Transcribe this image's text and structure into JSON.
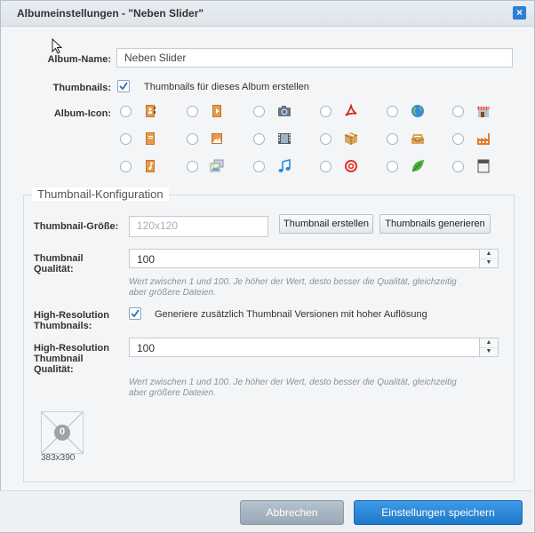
{
  "dialog": {
    "title": "Albumeinstellungen - \"Neben Slider\"",
    "close_icon": "close-icon"
  },
  "album": {
    "name_label": "Album-Name:",
    "name_value": "Neben Slider",
    "thumbnails_label": "Thumbnails:",
    "thumbnails_checked": true,
    "thumbnails_text": "Thumbnails für dieses Album erstellen",
    "icon_label": "Album-Icon:",
    "icons": [
      [
        "address-book-icon",
        "book-play-icon",
        "camera-icon",
        "pdf-icon",
        "globe-icon",
        "shop-icon"
      ],
      [
        "notebook-icon",
        "picture-icon",
        "film-icon",
        "box-icon",
        "inbox-icon",
        "factory-icon"
      ],
      [
        "music-book-icon",
        "images-icon",
        "music-note-icon",
        "target-icon",
        "leaf-icon",
        "document-icon"
      ]
    ]
  },
  "thumb": {
    "legend": "Thumbnail-Konfiguration",
    "size_label": "Thumbnail-Größe:",
    "size_placeholder": "120x120",
    "create_btn": "Thumbnail erstellen",
    "generate_btn": "Thumbnails generieren",
    "quality_label_1": "Thumbnail",
    "quality_label_2": "Qualität:",
    "quality_value": "100",
    "quality_help_1": "Wert zwischen 1 und 100. Je höher der Wert, desto besser die Qualität, gleichzeitig",
    "quality_help_2": "aber größere Dateien.",
    "hires_label_1": "High-Resolution",
    "hires_label_2": "Thumbnails:",
    "hires_checked": true,
    "hires_text": "Generiere zusätzlich Thumbnail Versionen mit hoher Auflösung",
    "hires_q_label_1": "High-Resolution",
    "hires_q_label_2": "Thumbnail",
    "hires_q_label_3": "Qualität:",
    "hires_q_value": "100",
    "hires_help_1": "Wert zwischen 1 und 100. Je höher der Wert, desto besser die Qualität, gleichzeitig",
    "hires_help_2": "aber größere Dateien.",
    "preview_badge": "0",
    "preview_size": "383x390"
  },
  "footer": {
    "cancel": "Abbrechen",
    "save": "Einstellungen speichern"
  },
  "colors": {
    "primary": "#1e78c8",
    "cancel": "#9aa8b5"
  }
}
